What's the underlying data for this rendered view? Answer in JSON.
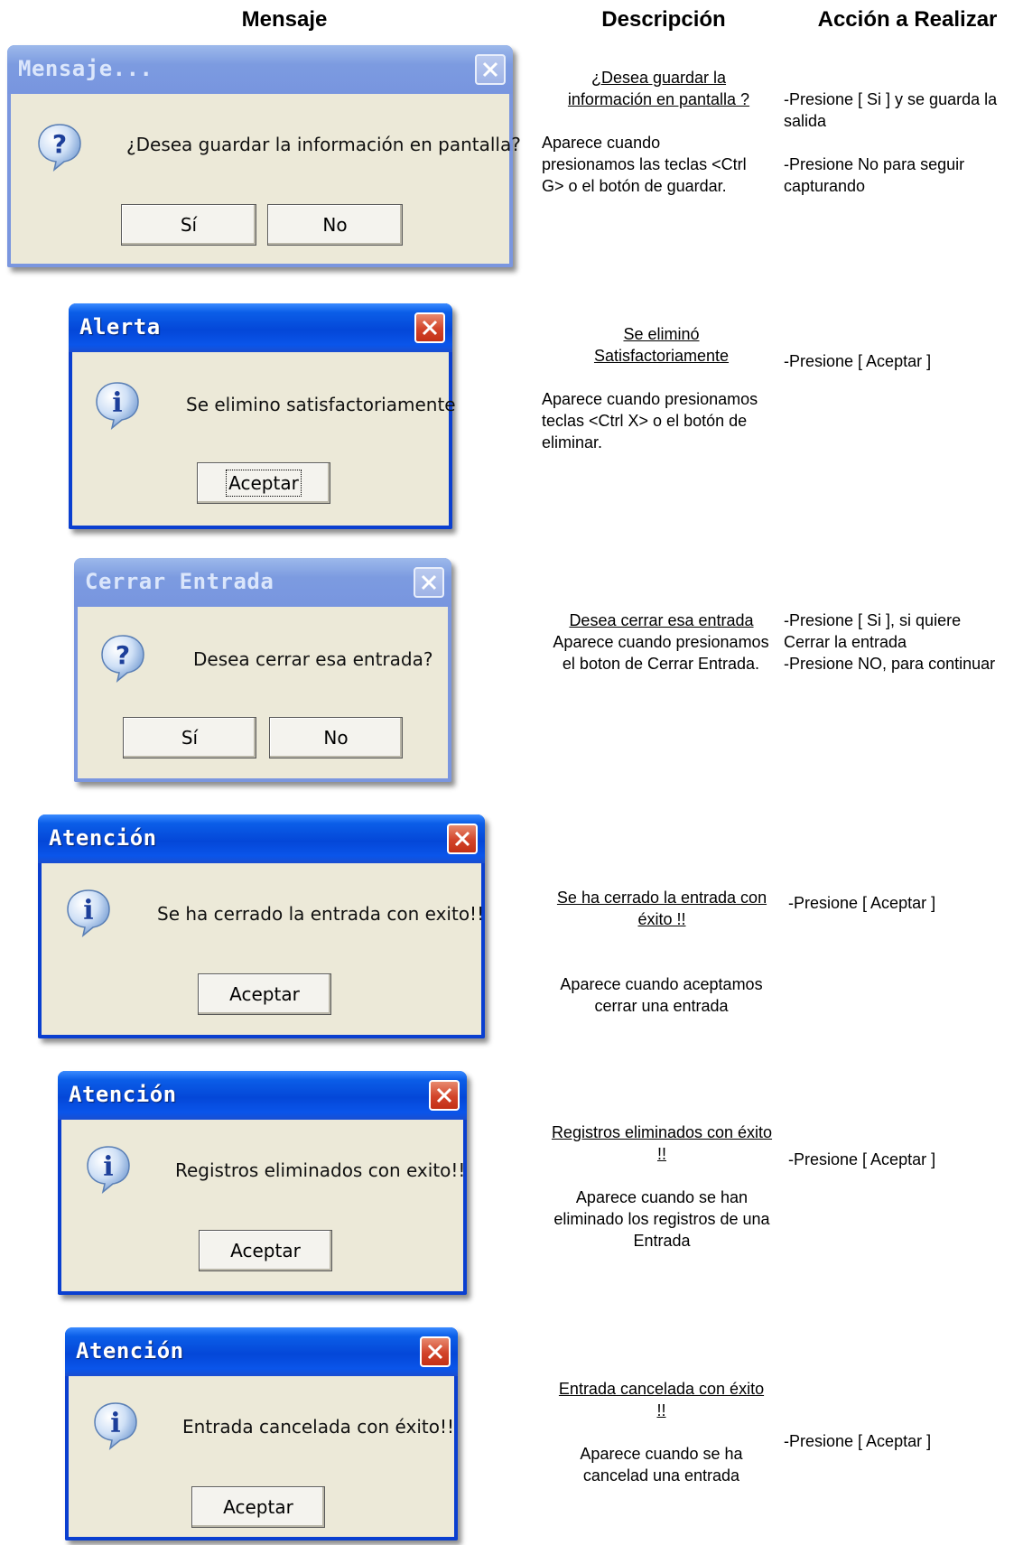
{
  "headers": {
    "mensaje": "Mensaje",
    "descripcion": "Descripción",
    "accion": "Acción a Realizar"
  },
  "rows": [
    {
      "dialog": {
        "title": "Mensaje...",
        "text": "¿Desea guardar la información en pantalla?",
        "icon": "question-icon",
        "buttons": [
          "Sí",
          "No"
        ],
        "state": "inactive"
      },
      "desc_title": "¿Desea guardar la información en pantalla ?",
      "desc_body": "Aparece cuando presionamos las teclas <Ctrl G> o el botón de guardar.",
      "action_1": "-Presione [ Si ] y se guarda la salida",
      "action_2": "-Presione No para seguir capturando"
    },
    {
      "dialog": {
        "title": "Alerta",
        "text": "Se elimino satisfactoriamente",
        "icon": "info-icon",
        "buttons": [
          "Aceptar"
        ],
        "state": "active"
      },
      "desc_title": "Se eliminó Satisfactoriamente",
      "desc_body": "Aparece cuando presionamos teclas <Ctrl X> o el botón de eliminar.",
      "action_1": "-Presione [ Aceptar ]"
    },
    {
      "dialog": {
        "title": "Cerrar Entrada",
        "text": "Desea cerrar esa entrada?",
        "icon": "question-icon",
        "buttons": [
          "Sí",
          "No"
        ],
        "state": "inactive"
      },
      "desc_title": "Desea cerrar esa entrada",
      "desc_body": "Aparece cuando presionamos el boton de Cerrar Entrada.",
      "action_1": "-Presione [ Si ], si quiere Cerrar la entrada",
      "action_2": "-Presione NO, para continuar"
    },
    {
      "dialog": {
        "title": "Atención",
        "text": "Se ha cerrado la entrada con exito!!",
        "icon": "info-icon",
        "buttons": [
          "Aceptar"
        ],
        "state": "active"
      },
      "desc_title": "Se ha cerrado la entrada con éxito !!",
      "desc_body": "Aparece cuando aceptamos cerrar una entrada",
      "action_1": "-Presione [ Aceptar ]"
    },
    {
      "dialog": {
        "title": "Atención",
        "text": "Registros eliminados con exito!!",
        "icon": "info-icon",
        "buttons": [
          "Aceptar"
        ],
        "state": "active"
      },
      "desc_title": "Registros eliminados con éxito !!",
      "desc_body": "Aparece cuando se han eliminado los registros de una Entrada",
      "action_1": "-Presione [ Aceptar ]"
    },
    {
      "dialog": {
        "title": "Atención",
        "text": "Entrada cancelada con éxito!!",
        "icon": "info-icon",
        "buttons": [
          "Aceptar"
        ],
        "state": "active"
      },
      "desc_title": "Entrada cancelada con éxito !!",
      "desc_body": "Aparece cuando se ha cancelad una entrada",
      "action_1": "-Presione [ Aceptar ]"
    }
  ]
}
